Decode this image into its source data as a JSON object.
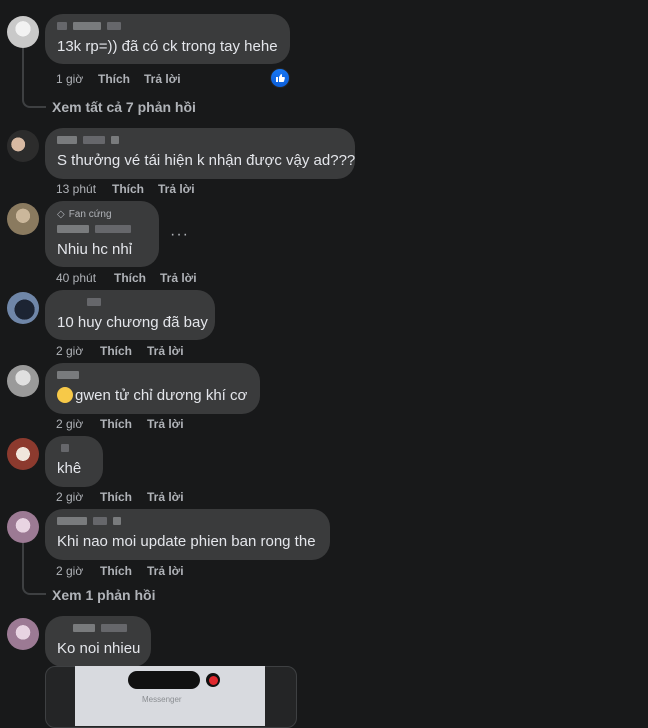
{
  "comments": [
    {
      "text": "13k rp=)) đã có ck trong tay hehe",
      "time": "1 giờ",
      "like": "Thích",
      "reply": "Trả lời",
      "replies_link": "Xem tất cả 7 phản hồi",
      "liked": true
    },
    {
      "text": "S thưởng vé tái hiện k nhận được vậy ad???",
      "time": "13 phút",
      "like": "Thích",
      "reply": "Trả lời"
    },
    {
      "badge": "Fan cứng",
      "text": "Nhiu hc nhỉ",
      "time": "40 phút",
      "like": "Thích",
      "reply": "Trả lời",
      "more": "···"
    },
    {
      "text": "10 huy chương đã bay",
      "time": "2 giờ",
      "like": "Thích",
      "reply": "Trả lời"
    },
    {
      "text": "gwen tử chỉ dương khí cơ",
      "time": "2 giờ",
      "like": "Thích",
      "reply": "Trả lời"
    },
    {
      "text": "khê",
      "time": "2 giờ",
      "like": "Thích",
      "reply": "Trả lời"
    },
    {
      "text": "Khi nao moi update phien ban rong the",
      "time": "2 giờ",
      "like": "Thích",
      "reply": "Trả lời",
      "replies_link": "Xem 1 phản hồi"
    },
    {
      "text": "Ko noi nhieu"
    }
  ],
  "preview": {
    "label": "Messenger"
  },
  "colors": {
    "background": "#18191a",
    "bubble": "#3a3b3c",
    "text": "#e4e6eb",
    "secondary": "#b0b3b8",
    "like_blue": "#1877f2"
  }
}
